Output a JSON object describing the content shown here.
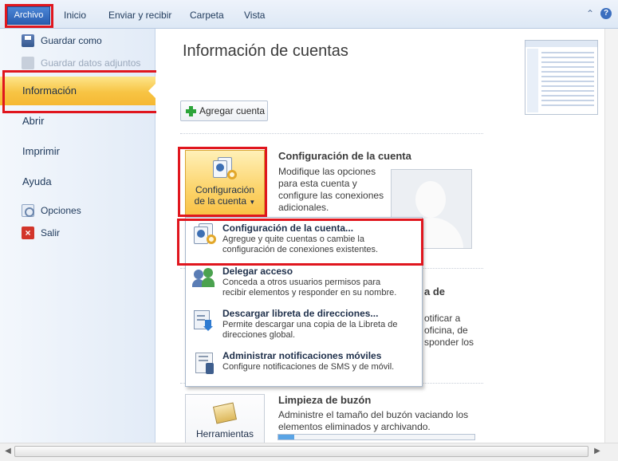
{
  "ribbon": {
    "tabs": [
      "Archivo",
      "Inicio",
      "Enviar y recibir",
      "Carpeta",
      "Vista"
    ],
    "icons": [
      "collapse-ribbon-icon",
      "help-icon"
    ]
  },
  "leftnav": {
    "save_as": "Guardar como",
    "save_attachments": "Guardar datos adjuntos",
    "info": "Información",
    "open": "Abrir",
    "print": "Imprimir",
    "help": "Ayuda",
    "options": "Opciones",
    "exit": "Salir"
  },
  "main": {
    "title": "Información de cuentas",
    "add_account": "Agregar cuenta",
    "account_settings": {
      "button_line1": "Configuración",
      "button_line2": "de la cuenta",
      "title": "Configuración de la cuenta",
      "lines": [
        "Modifique las opciones",
        "para esta cuenta y",
        "configure las conexiones",
        "adicionales."
      ]
    },
    "partial_section": {
      "title_fragment": "a de",
      "lines": [
        "otificar a",
        "oficina, de",
        "sponder los"
      ]
    },
    "cleanup": {
      "button_label": "Herramientas",
      "title": "Limpieza de buzón",
      "lines": [
        "Administre el tamaño del buzón vaciando los",
        "elementos eliminados y archivando."
      ],
      "usage_fraction": 0.08
    }
  },
  "dropdown": {
    "items": [
      {
        "title": "Configuración de la cuenta...",
        "lines": [
          "Agregue y quite cuentas o cambie la",
          "configuración de conexiones existentes."
        ]
      },
      {
        "title": "Delegar acceso",
        "lines": [
          "Conceda a otros usuarios permisos para",
          "recibir elementos y responder en su nombre."
        ]
      },
      {
        "title": "Descargar libreta de direcciones...",
        "lines": [
          "Permite descargar una copia de la Libreta de",
          "direcciones global."
        ]
      },
      {
        "title": "Administrar notificaciones móviles",
        "lines": [
          "Configure notificaciones de SMS y de móvil."
        ]
      }
    ]
  }
}
